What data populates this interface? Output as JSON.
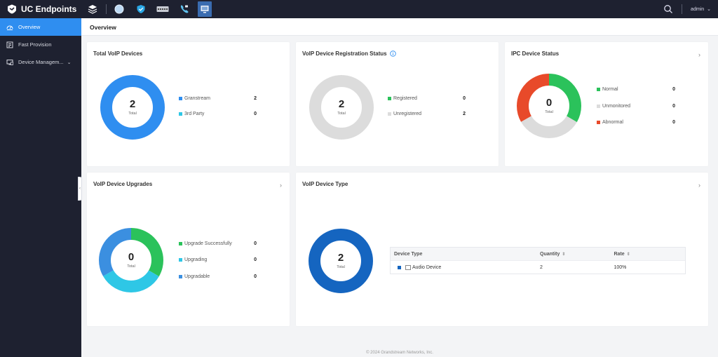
{
  "app": {
    "title": "UC Endpoints"
  },
  "topbar": {
    "apps": [
      {
        "icon": "layers-icon"
      },
      {
        "icon": "globe-icon"
      },
      {
        "icon": "shield-icon"
      },
      {
        "icon": "switch-icon"
      },
      {
        "icon": "phone-icon"
      },
      {
        "icon": "monitor-icon"
      }
    ],
    "user": "admin",
    "caret": "⌄"
  },
  "sidebar": {
    "items": [
      {
        "label": "Overview",
        "icon": "dashboard-icon",
        "active": true
      },
      {
        "label": "Fast Provision",
        "icon": "provision-icon"
      },
      {
        "label": "Device Managem...",
        "icon": "device-icon",
        "chevron": "⌄"
      }
    ]
  },
  "page": {
    "title": "Overview"
  },
  "cards": {
    "total": {
      "title": "Total VoIP Devices",
      "center_value": "2",
      "center_label": "Total",
      "legend": [
        {
          "label": "Granstream",
          "value": "2",
          "color": "#2f8ef0"
        },
        {
          "label": "3rd Party",
          "value": "0",
          "color": "#2ec7e6"
        }
      ]
    },
    "registration": {
      "title": "VoIP Device Registration Status",
      "center_value": "2",
      "center_label": "Total",
      "legend": [
        {
          "label": "Registered",
          "value": "0",
          "color": "#2bc25b"
        },
        {
          "label": "Unregistered",
          "value": "2",
          "color": "#dcdcdc"
        }
      ]
    },
    "ipc": {
      "title": "IPC Device Status",
      "arrow": "›",
      "center_value": "0",
      "center_label": "Total",
      "legend": [
        {
          "label": "Normal",
          "value": "0",
          "color": "#2bc25b"
        },
        {
          "label": "Unmonitored",
          "value": "0",
          "color": "#dcdcdc"
        },
        {
          "label": "Abnormal",
          "value": "0",
          "color": "#e84a2a"
        }
      ]
    },
    "upgrades": {
      "title": "VoIP Device Upgrades",
      "arrow": "›",
      "center_value": "0",
      "center_label": "Total",
      "legend": [
        {
          "label": "Upgrade Successfully",
          "value": "0",
          "color": "#2bc25b"
        },
        {
          "label": "Upgrading",
          "value": "0",
          "color": "#2ec7e6"
        },
        {
          "label": "Upgradable",
          "value": "0",
          "color": "#3b8fe0"
        }
      ]
    },
    "type": {
      "title": "VoIP Device Type",
      "arrow": "›",
      "center_value": "2",
      "center_label": "Total",
      "table": {
        "headers": [
          "Device Type",
          "Quantity",
          "Rate"
        ],
        "rows": [
          {
            "type": "Audio Device",
            "quantity": "2",
            "rate": "100%",
            "color": "#1565c0"
          }
        ]
      }
    }
  },
  "footer": {
    "copyright": "© 2024 Grandstream Networks, Inc."
  }
}
